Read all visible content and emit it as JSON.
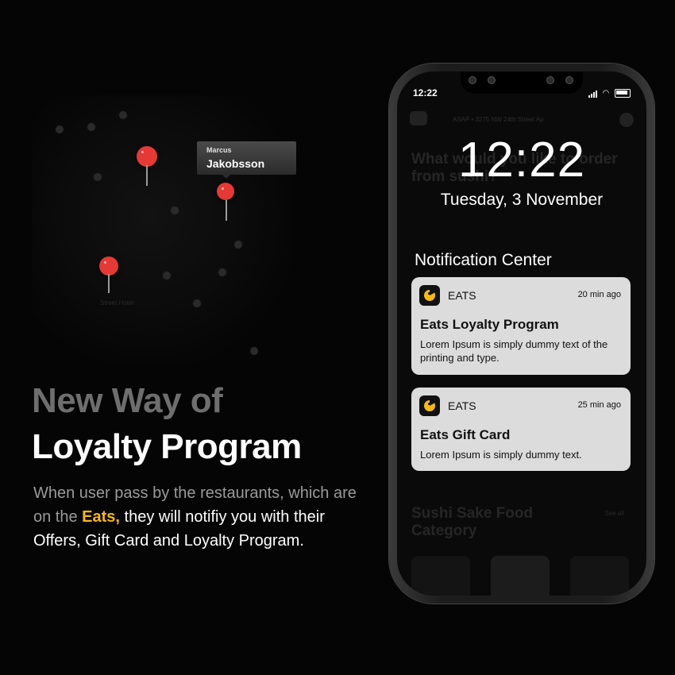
{
  "map": {
    "tooltip": {
      "first_name": "Marcus",
      "last_name": "Jakobsson"
    },
    "label": "Street Hotel"
  },
  "headline": {
    "line1": "New Way of",
    "line2": "Loyalty Program"
  },
  "paragraph": {
    "part1": "When user pass by the restaurants, which are on the ",
    "highlight": "Eats,",
    "part2": " they will notifiy you with their Offers, Gift Card and Loyalty Program."
  },
  "phone": {
    "status_time": "12:22",
    "lock_time": "12:22",
    "lock_date": "Tuesday, 3 November",
    "notification_center_title": "Notification Center",
    "background_app": {
      "address": "ASAP • 3275 NW 24th Street Ap",
      "question": "What would you like to order from sushi?",
      "category": "Sushi Sake Food Category",
      "see_all": "See all"
    },
    "notifications": [
      {
        "app": "EATS",
        "time": "20 min ago",
        "title": "Eats Loyalty Program",
        "body": "Lorem Ipsum is simply dummy text of the printing and type."
      },
      {
        "app": "EATS",
        "time": "25 min ago",
        "title": "Eats Gift Card",
        "body": "Lorem Ipsum is simply dummy text."
      }
    ]
  },
  "colors": {
    "accent": "#f5b818",
    "pin": "#e53935",
    "card": "#dcdcdc"
  }
}
